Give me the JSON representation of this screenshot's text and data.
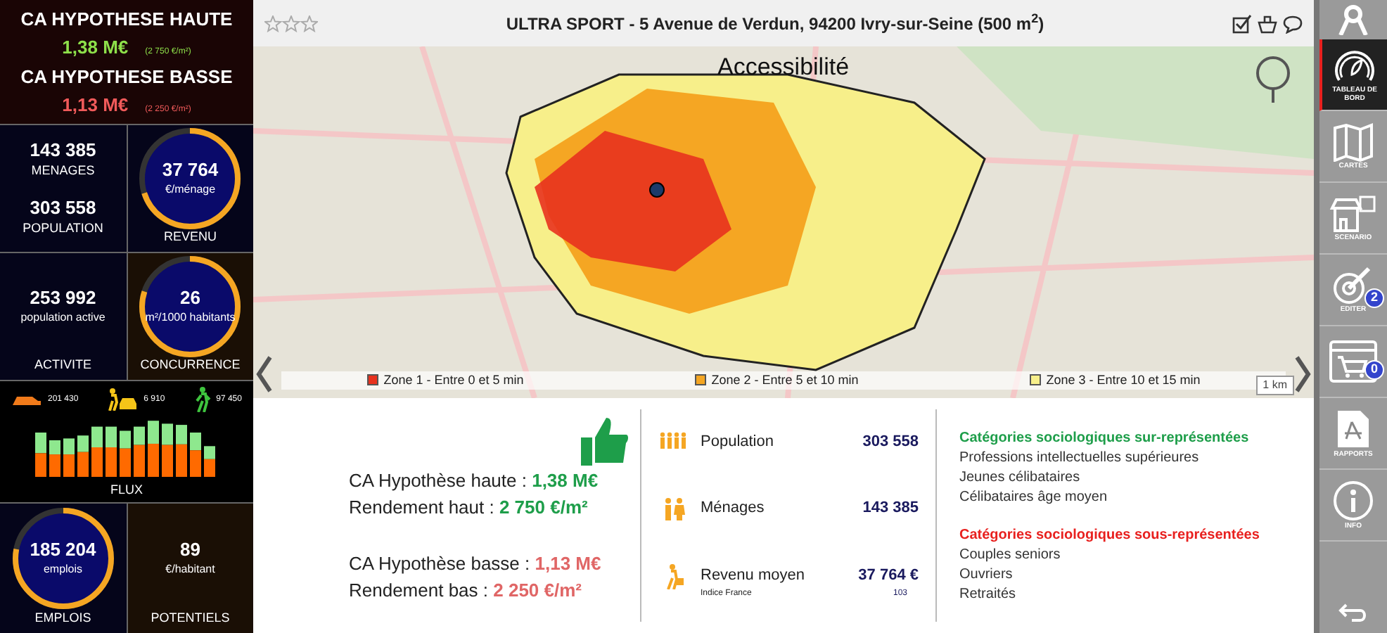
{
  "summary": {
    "high": {
      "title": "CA HYPOTHESE HAUTE",
      "value": "1,38 M€",
      "yield": "(2 750 €/m²)"
    },
    "low": {
      "title": "CA HYPOTHESE BASSE",
      "value": "1,13 M€",
      "yield": "(2 250 €/m²)"
    }
  },
  "tiles": [
    {
      "kind": "double",
      "values": [
        {
          "value": "143 385",
          "label": "MENAGES"
        },
        {
          "value": "303 558",
          "label": "POPULATION"
        }
      ]
    },
    {
      "kind": "ring",
      "value": "37 764",
      "unit": "€/ménage",
      "caption": "REVENU",
      "level": 0.7
    },
    {
      "kind": "plain",
      "value": "253 992",
      "unit": "population active",
      "caption": "ACTIVITE"
    },
    {
      "kind": "ring",
      "value": "26",
      "unit": "m²/1000 habitants",
      "caption": "CONCURRENCE",
      "level": 0.8
    }
  ],
  "flux": {
    "caption": "FLUX",
    "counts": [
      {
        "kind": "car",
        "value": "201 430"
      },
      {
        "kind": "walk-car",
        "value": "6 910"
      },
      {
        "kind": "walk",
        "value": "97 450"
      }
    ]
  },
  "bottom_tiles": [
    {
      "kind": "ring",
      "value": "185 204",
      "unit": "emplois",
      "caption": "EMPLOIS",
      "level": 0.78
    },
    {
      "kind": "plain",
      "value": "89",
      "unit": "€/habitant",
      "caption": "POTENTIELS"
    }
  ],
  "header": {
    "stars": 0,
    "title": "ULTRA SPORT  -  5 Avenue de Verdun, 94200 Ivry-sur-Seine (500 m$^{2}$)"
  },
  "map": {
    "title": "Accessibilité",
    "scale": "1 km",
    "legend": [
      {
        "label": "Zone 1 - Entre 0 et 5 min",
        "color": "#e8321e"
      },
      {
        "label": "Zone 2 - Entre 5 et 10 min",
        "color": "#f5a623"
      },
      {
        "label": "Zone 3 - Entre 10 et 15 min",
        "color": "#f7ef8a"
      }
    ]
  },
  "results": [
    {
      "label": "CA Hypothèse haute : ",
      "value": "1,38 M€",
      "color": "#1e9e4a"
    },
    {
      "label": "Rendement haut : ",
      "value": "2 750 €/m²",
      "color": "#1e9e4a"
    },
    {
      "label": "CA Hypothèse basse : ",
      "value": "1,13 M€",
      "color": "#e06666"
    },
    {
      "label": "Rendement bas : ",
      "value": "2 250 €/m²",
      "color": "#e06666"
    }
  ],
  "stats": [
    {
      "kind": "population",
      "label": "Population",
      "value": "303 558"
    },
    {
      "kind": "households",
      "label": "Ménages",
      "value": "143 385"
    },
    {
      "kind": "income",
      "label": "Revenu moyen",
      "value": "37 764 €",
      "sub_label": "Indice France",
      "sub_value": "103"
    }
  ],
  "categories": [
    {
      "kind": "over",
      "title": "Catégories sociologiques sur-représentées",
      "items": [
        "Professions intellectuelles supérieures",
        "Jeunes célibataires",
        "Célibataires âge moyen"
      ]
    },
    {
      "kind": "under",
      "title": "Catégories sociologiques sous-représentées",
      "items": [
        "Couples seniors",
        "Ouvriers",
        "Retraités"
      ]
    }
  ],
  "sidebar": [
    {
      "kind": "dashboard",
      "label": "TABLEAU DE BORD",
      "selected": true
    },
    {
      "kind": "map",
      "label": "CARTES",
      "selected": false
    },
    {
      "kind": "shop",
      "label": "SCENARIO",
      "selected": false
    },
    {
      "kind": "edit",
      "label": "EDITER",
      "badge": "2",
      "selected": false
    },
    {
      "kind": "cart",
      "badge": "0",
      "selected": false
    },
    {
      "kind": "pdf",
      "label": "RAPPORTS",
      "selected": false
    },
    {
      "kind": "info",
      "label": "INFO",
      "selected": false
    }
  ]
}
